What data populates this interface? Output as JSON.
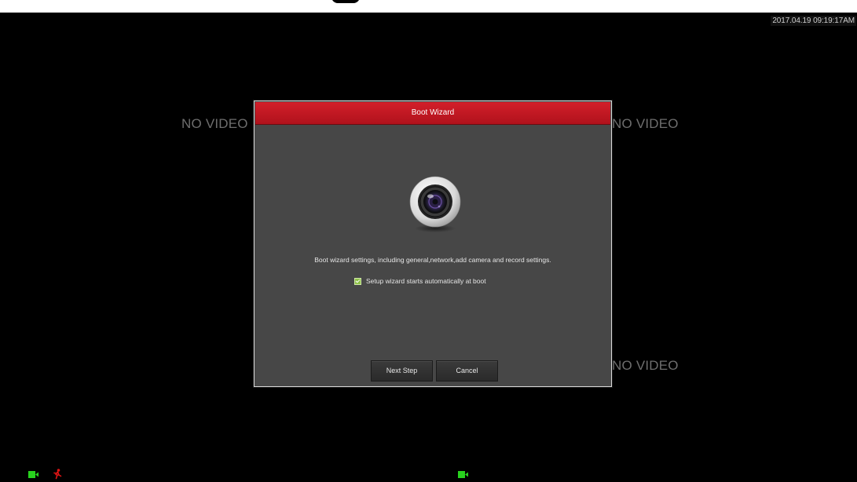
{
  "overlay": {
    "timestamp": "2017.04.19 09:19:17AM"
  },
  "channels": {
    "no_video_label": "NO VIDEO",
    "no_video_label_cut": "NO VIDEO"
  },
  "dialog": {
    "title": "Boot Wizard",
    "icon": "camera-lens-icon",
    "description": "Boot wizard settings, including general,network,add camera and record settings.",
    "auto_start_checkbox": {
      "label": "Setup wizard starts automatically at boot",
      "checked": true
    },
    "buttons": {
      "next_label": "Next Step",
      "cancel_label": "Cancel"
    }
  },
  "status_icons": [
    {
      "name": "record-camera-icon",
      "color": "#28d21e"
    },
    {
      "name": "motion-alarm-icon",
      "color": "#e01414"
    },
    {
      "name": "record-camera-icon",
      "color": "#28d21e"
    }
  ],
  "colors": {
    "header_red": "#c4161f",
    "dialog_bg": "#474747",
    "no_video_text": "#6e6e6e",
    "status_green": "#28d21e",
    "motion_red": "#e01414"
  }
}
